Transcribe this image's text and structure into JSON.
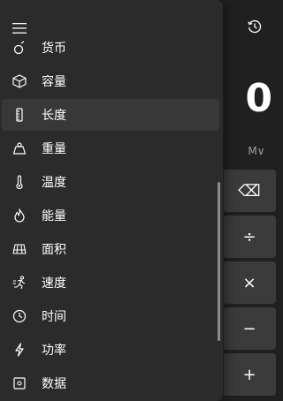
{
  "nav": {
    "items": [
      {
        "label": "货币",
        "icon": "currency-icon"
      },
      {
        "label": "容量",
        "icon": "volume-cube-icon"
      },
      {
        "label": "长度",
        "icon": "ruler-icon",
        "selected": true
      },
      {
        "label": "重量",
        "icon": "weight-icon"
      },
      {
        "label": "温度",
        "icon": "thermometer-icon"
      },
      {
        "label": "能量",
        "icon": "flame-icon"
      },
      {
        "label": "面积",
        "icon": "area-grid-icon"
      },
      {
        "label": "速度",
        "icon": "speed-runner-icon"
      },
      {
        "label": "时间",
        "icon": "clock-icon"
      },
      {
        "label": "功率",
        "icon": "lightning-icon"
      },
      {
        "label": "数据",
        "icon": "data-icon"
      }
    ]
  },
  "calculator": {
    "display_value": "0",
    "memory_label": "M∨",
    "operators": [
      "⌫",
      "÷",
      "×",
      "−",
      "+"
    ]
  },
  "colors": {
    "background": "#202020",
    "drawer": "#2b2b2b",
    "selected": "#383838",
    "operator_button": "#3b3b3b"
  }
}
